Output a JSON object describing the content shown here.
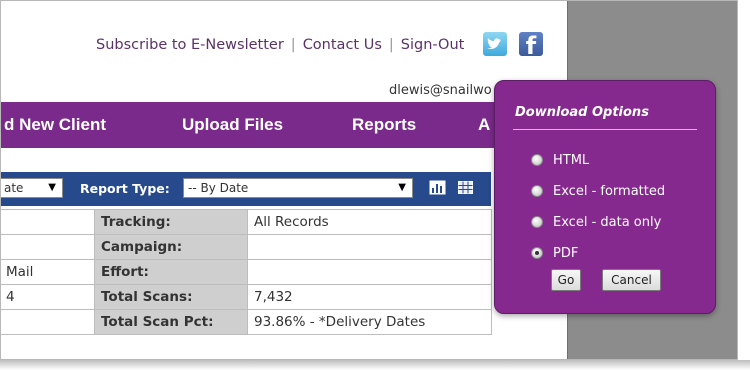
{
  "header": {
    "links": [
      "Subscribe to E-Newsletter",
      "Contact Us",
      "Sign-Out"
    ],
    "separator": "|",
    "user_email": "dlewis@snailwo"
  },
  "social": {
    "twitter_icon": "twitter-icon",
    "facebook_icon": "facebook-icon",
    "facebook_glyph": "f"
  },
  "nav": {
    "items": [
      "d New Client",
      "Upload Files",
      "Reports",
      "A"
    ]
  },
  "toolbar": {
    "left_select_value": "ate",
    "report_type_label": "Report Type:",
    "report_type_value": "-- By Date"
  },
  "report_table": {
    "rows": [
      {
        "left": "",
        "label": "Tracking:",
        "value": "All Records"
      },
      {
        "left": "",
        "label": "Campaign:",
        "value": ""
      },
      {
        "left": "Mail",
        "label": "Effort:",
        "value": ""
      },
      {
        "left": "4",
        "label": "Total Scans:",
        "value": "7,432"
      },
      {
        "left": "",
        "label": "Total Scan Pct:",
        "value": "93.86% - *Delivery Dates"
      }
    ]
  },
  "download_options": {
    "title": "Download Options",
    "options": [
      "HTML",
      "Excel - formatted",
      "Excel - data only",
      "PDF"
    ],
    "selected": "PDF",
    "go_label": "Go",
    "cancel_label": "Cancel"
  },
  "colors": {
    "nav": "#7a2a8b",
    "toolbar": "#274a8c",
    "popup": "#86298f",
    "gray_area": "#8c8c8c"
  }
}
